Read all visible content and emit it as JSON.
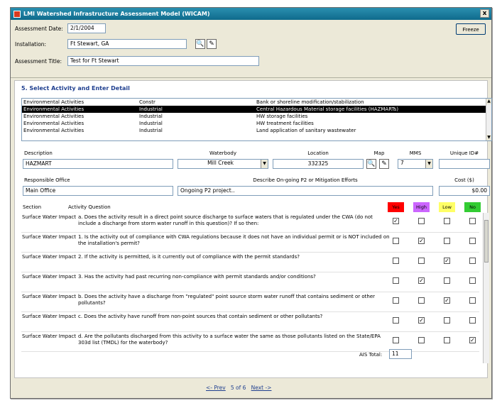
{
  "window": {
    "title": "LMI Watershed Infrastructure Assessment Model (WICAM)",
    "close_label": "x"
  },
  "header": {
    "date_label": "Assessment Date:",
    "date_value": "2/1/2004",
    "installation_label": "Installation:",
    "installation_value": "Ft Stewart, GA",
    "title_label": "Assessment Title:",
    "title_value": "Test for Ft Stewart",
    "freeze_label": "Freeze"
  },
  "section": {
    "title": "5. Select Activity and Enter Detail"
  },
  "activities": [
    {
      "category": "Environmental Activities",
      "type": "Constr",
      "detail": "Bank or shoreline modification/stabilization"
    },
    {
      "category": "Environmental Activities",
      "type": "Industrial",
      "detail": "Central Hazardous Material storage facilities (HAZMARTs)"
    },
    {
      "category": "Environmental Activities",
      "type": "Industrial",
      "detail": "HW storage facilities"
    },
    {
      "category": "Environmental Activities",
      "type": "Industrial",
      "detail": "HW treatment facilities"
    },
    {
      "category": "Environmental Activities",
      "type": "Industrial",
      "detail": "Land application of sanitary wastewater"
    }
  ],
  "detail": {
    "description_label": "Description",
    "description_value": "HAZMART",
    "waterbody_label": "Waterbody",
    "waterbody_value": "Mill Creek",
    "location_label": "Location",
    "location_value": "332325",
    "map_label": "Map",
    "mms_label": "MMS",
    "mms_value": "7",
    "uid_label": "Unique ID#",
    "uid_value": "",
    "office_label": "Responsible Office",
    "office_value": "Main Office",
    "efforts_label": "Describe On-going P2 or Mitigation Efforts",
    "efforts_value": "Ongoing P2 project..",
    "cost_label": "Cost ($)",
    "cost_value": "$0.00"
  },
  "grid": {
    "col_section": "Section",
    "col_question": "Activity Question",
    "col_yes": "Yes",
    "col_high": "High",
    "col_low": "Low",
    "col_no": "No",
    "colors": {
      "yes": "#ff0000",
      "high": "#cc66ff",
      "low": "#ffff66",
      "no": "#33cc33"
    },
    "rows": [
      {
        "section": "Surface Water Impact",
        "question": "a. Does the activity result in a direct point source discharge to surface waters that is regulated under the CWA (do not include a discharge from storm water runoff in this question)? If so then:",
        "answer": "yes"
      },
      {
        "section": "Surface Water Impact",
        "question": "1. Is the activity out of compliance with CWA regulations because it does not have an individual permit or is NOT included on the installation's permit?",
        "answer": "high"
      },
      {
        "section": "Surface Water Impact",
        "question": "2. If the activity is permitted, is it currently out of compliance with the permit standards?",
        "answer": "low"
      },
      {
        "section": "Surface Water Impact",
        "question": "3. Has the activity had past recurring non-compliance with permit standards and/or conditions?",
        "answer": "high"
      },
      {
        "section": "Surface Water Impact",
        "question": "b. Does the activity have a discharge from \"regulated\" point source storm water runoff that contains sediment or other pollutants?",
        "answer": "low"
      },
      {
        "section": "Surface Water Impact",
        "question": "c. Does the activity have runoff from non-point sources that contain sediment or other pollutants?",
        "answer": "high"
      },
      {
        "section": "Surface Water Impact",
        "question": "d. Are the pollutants discharged from this activity to a surface water the same as those pollutants listed on the State/EPA 303d list (TMDL) for the waterbody?",
        "answer": "no"
      }
    ],
    "total_label": "AIS Total:",
    "total_value": "11"
  },
  "nav": {
    "prev": "<- Prev",
    "page": "5 of 6",
    "next": "Next ->"
  }
}
